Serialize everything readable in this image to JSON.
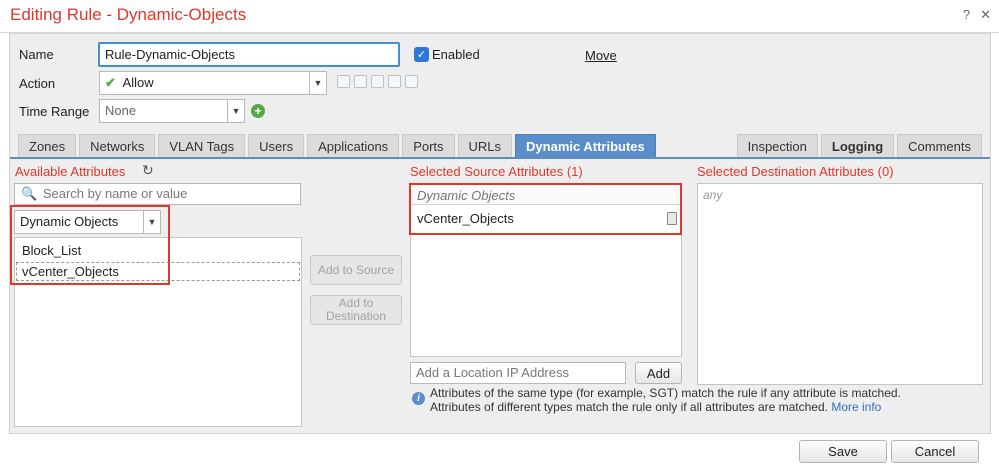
{
  "window": {
    "title": "Editing Rule - Dynamic-Objects",
    "help_label": "?",
    "close_label": "✕"
  },
  "form": {
    "name_label": "Name",
    "name_value": "Rule-Dynamic-Objects",
    "enabled_label": "Enabled",
    "move_label": "Move",
    "action_label": "Action",
    "action_value": "Allow",
    "time_range_label": "Time Range",
    "time_range_value": "None"
  },
  "tabs": {
    "left": [
      "Zones",
      "Networks",
      "VLAN Tags",
      "Users",
      "Applications",
      "Ports",
      "URLs",
      "Dynamic Attributes"
    ],
    "right": [
      "Inspection",
      "Logging",
      "Comments"
    ],
    "active": "Dynamic Attributes"
  },
  "available": {
    "heading": "Available Attributes",
    "search_placeholder": "Search by name or value",
    "type_value": "Dynamic Objects",
    "items": [
      "Block_List",
      "vCenter_Objects"
    ]
  },
  "buttons": {
    "add_source": "Add to Source",
    "add_destination": "Add to Destination",
    "add": "Add",
    "save": "Save",
    "cancel": "Cancel"
  },
  "selected_source": {
    "heading": "Selected Source Attributes (1)",
    "group_label": "Dynamic Objects",
    "items": [
      "vCenter_Objects"
    ],
    "location_placeholder": "Add a Location IP Address"
  },
  "selected_destination": {
    "heading": "Selected Destination Attributes (0)",
    "placeholder": "any"
  },
  "info": {
    "line1": "Attributes of the same type (for example, SGT) match the rule if any attribute is matched.",
    "line2": "Attributes of different types match the rule only if all attributes are matched.",
    "more_info": "More info"
  },
  "colors": {
    "title_red": "#e0372b",
    "active_tab": "#5b8ec8",
    "link_blue": "#2e6fc2",
    "allow_green": "#56a845"
  }
}
